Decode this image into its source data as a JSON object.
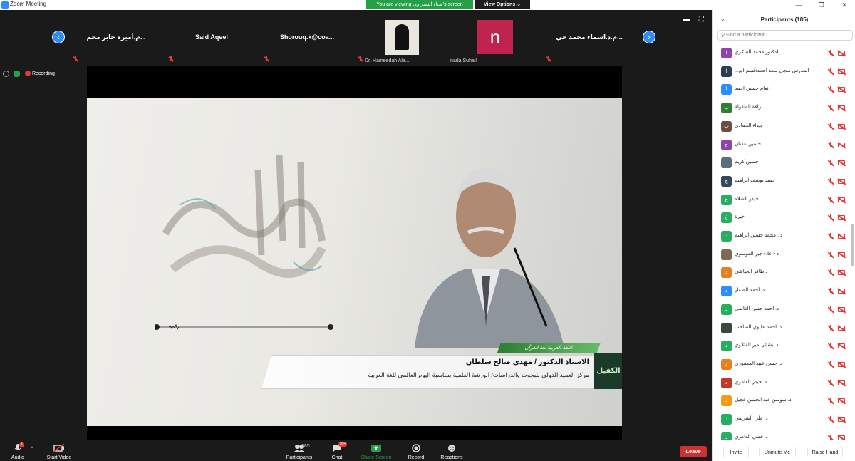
{
  "window": {
    "title": "Zoom Meeting",
    "controls": {
      "minimize": "—",
      "maximize": "❐",
      "close": "✕"
    }
  },
  "share_banner": {
    "text": "You are viewing ضياء النصراوي's screen",
    "view_options": "View Options ⌄"
  },
  "recording": {
    "label": "Recording"
  },
  "thumbnails": [
    {
      "name": "م.أميرة جابر محم...",
      "subname": ""
    },
    {
      "name": "Said Aqeel",
      "subname": ""
    },
    {
      "name": "Shorouq.k@coa...",
      "subname": ""
    },
    {
      "name": "",
      "subname": "Dr. Hameedah Ala..."
    },
    {
      "name": "n",
      "subname": "nada Suhail"
    },
    {
      "name": "م.د.اسماء محمد خي...",
      "subname": ""
    }
  ],
  "slide": {
    "green_bar": "اللغة العربية لغة القرآن",
    "caption_line1": "الاستاذ الدكتور / مهدي صالح سلطان",
    "caption_line2": "مركز العميد الدولي للبحوث والدراسات/ الورشة العلمية بمناسبة اليوم العالمي للغة العربية",
    "logo_text": "الكفيل"
  },
  "sidebar": {
    "title": "Participants (185)",
    "search_placeholder": "Find a participant",
    "participants": [
      {
        "name": "الدكتور محمد الشكري",
        "initial": "ا",
        "color": "#8e44ad"
      },
      {
        "name": "المدرس سجى سعد احمد/قسم الع...",
        "initial": "ا",
        "color": "#2c3e50"
      },
      {
        "name": "انعام حسين احمد",
        "initial": "ا",
        "color": "#2d8cff"
      },
      {
        "name": "براءة الطفولة",
        "initial": "ب",
        "color": "#2e7d32"
      },
      {
        "name": "بيداء الحمادي",
        "initial": "ب",
        "color": "#6d4c41"
      },
      {
        "name": "حسين عدنان",
        "initial": "ح",
        "color": "#8e44ad"
      },
      {
        "name": "حسين كريم",
        "initial": "",
        "color": "#5d6d7e"
      },
      {
        "name": "حميد يوسف ابراهيم",
        "initial": "ح",
        "color": "#34495e"
      },
      {
        "name": "حيدر الشلاه",
        "initial": "ح",
        "color": "#27ae60"
      },
      {
        "name": "خيرة",
        "initial": "خ",
        "color": "#27ae60"
      },
      {
        "name": "د . محمد حسين ابراهيم",
        "initial": "د",
        "color": "#27ae60"
      },
      {
        "name": "د • علاء جبر الموسوي",
        "initial": "",
        "color": "#7f6a55"
      },
      {
        "name": "د ظافر الجياشي",
        "initial": "د",
        "color": "#e67e22"
      },
      {
        "name": "د. أحمد الصفار",
        "initial": "د",
        "color": "#2d8cff"
      },
      {
        "name": "د. أحمد حسن الغانمي",
        "initial": "د",
        "color": "#27ae60"
      },
      {
        "name": "د. احمد عليوي الصاحب",
        "initial": "",
        "color": "#3b4a3a"
      },
      {
        "name": "د. بشائر امير الفتلاوي",
        "initial": "د",
        "color": "#27ae60"
      },
      {
        "name": "د. حسن عبيد المعموري",
        "initial": "د",
        "color": "#e67e22"
      },
      {
        "name": "د. حيدر العامري",
        "initial": "د",
        "color": "#c0392b"
      },
      {
        "name": "د. سوسن عبد الحسن عجيل",
        "initial": "د",
        "color": "#f39c12"
      },
      {
        "name": "د. علي الشريفي",
        "initial": "د",
        "color": "#27ae60"
      },
      {
        "name": "د. قصي العامري",
        "initial": "د",
        "color": "#27ae60"
      }
    ],
    "footer": {
      "invite": "Invite",
      "mute": "Unmute Me",
      "raise": "Raise Hand"
    }
  },
  "toolbar": {
    "audio": "Audio",
    "video": "Start Video",
    "participants": "Participants",
    "participants_count": "185",
    "chat": "Chat",
    "chat_badge": "99+",
    "share": "Share Screen",
    "record": "Record",
    "reactions": "Reactions",
    "leave": "Leave",
    "audio_badge": "1"
  }
}
